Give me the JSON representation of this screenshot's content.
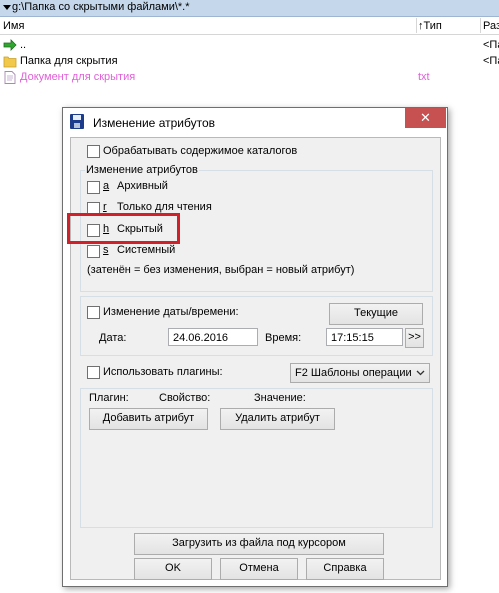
{
  "file_panel": {
    "path": "g:\\Папка со скрытыми файлами\\*.*",
    "columns": {
      "name": "Имя",
      "type": "↑Тип",
      "size": "Раз"
    },
    "rows": [
      {
        "name": "..",
        "type": "",
        "size": "<Па",
        "icon": "up-arrow-icon"
      },
      {
        "name": "Папка для скрытия",
        "type": "",
        "size": "<Па",
        "icon": "folder-icon"
      },
      {
        "name": "Документ для скрытия",
        "type": "txt",
        "size": "",
        "icon": "document-icon"
      }
    ]
  },
  "dialog": {
    "title": "Изменение атрибутов",
    "close_glyph": "✕",
    "process_subdirs_label": "Обрабатывать содержимое каталогов",
    "attributes_group_title": "Изменение атрибутов",
    "attributes": [
      {
        "key": "a",
        "label": "Архивный"
      },
      {
        "key": "r",
        "label": "Только для чтения"
      },
      {
        "key": "h",
        "label": "Скрытый"
      },
      {
        "key": "s",
        "label": "Системный"
      }
    ],
    "attributes_hint": "(затенён = без изменения, выбран = новый атрибут)",
    "datetime": {
      "checkbox_label": "Изменение даты/времени:",
      "now_button": "Текущие",
      "date_label": "Дата:",
      "date_value": "24.06.2016",
      "time_label": "Время:",
      "time_value": "17:15:15",
      "more_button": ">>"
    },
    "plugins": {
      "checkbox_label": "Использовать плагины:",
      "dropdown_value": "F2 Шаблоны операции",
      "col_plugin": "Плагин:",
      "col_property": "Свойство:",
      "col_value": "Значение:",
      "add_button": "Добавить атрибут",
      "delete_button": "Удалить атрибут"
    },
    "load_button": "Загрузить из файла под курсором",
    "ok_button": "OK",
    "cancel_button": "Отмена",
    "help_button": "Справка"
  },
  "colors": {
    "highlight_box": "#d0202a",
    "close_button": "#c75050",
    "hidden_file_text": "#e060d8"
  }
}
